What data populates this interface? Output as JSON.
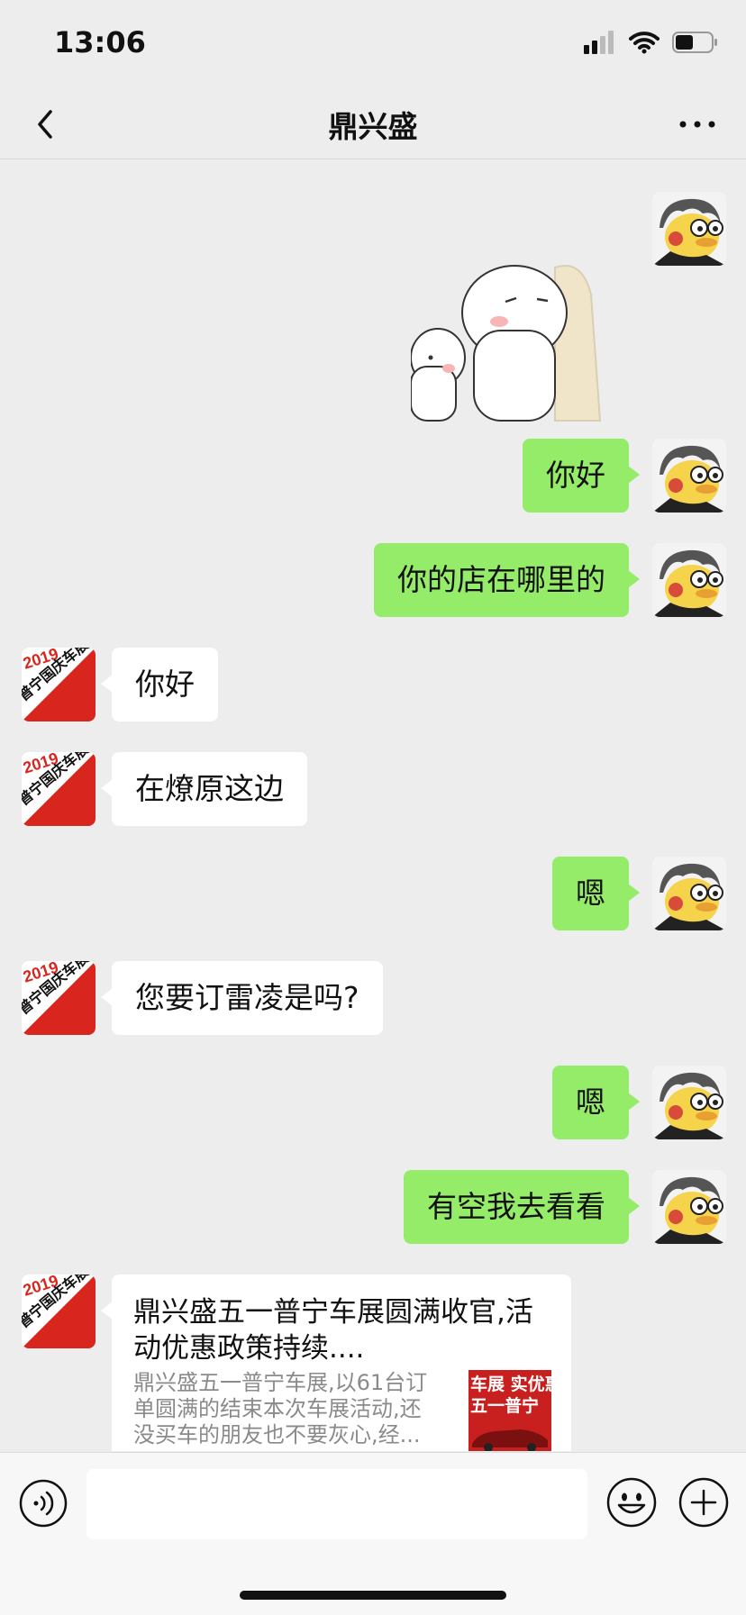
{
  "status_bar": {
    "time": "13:06",
    "battery_level": 0.5
  },
  "nav": {
    "title": "鼎兴盛"
  },
  "messages": [
    {
      "from": "me",
      "type": "sticker"
    },
    {
      "from": "me",
      "text": "你好"
    },
    {
      "from": "me",
      "text": "你的店在哪里的"
    },
    {
      "from": "shop",
      "text": "你好"
    },
    {
      "from": "shop",
      "text": "在燎原这边"
    },
    {
      "from": "me",
      "text": "嗯"
    },
    {
      "from": "shop",
      "text": "您要订雷凌是吗?"
    },
    {
      "from": "me",
      "text": "嗯"
    },
    {
      "from": "me",
      "text": "有空我去看看"
    },
    {
      "from": "shop",
      "type": "link",
      "title": "鼎兴盛五一普宁车展圆满收官,活动优惠政策持续....",
      "description": "鼎兴盛五一普宁车展,以61台订单圆满的结束本次车展活动,还没买车的朋友也不要灰心,经...",
      "thumbnail_text": [
        "车展 实优惠",
        "五一普宁"
      ]
    }
  ],
  "shop_avatar": {
    "year": "2019",
    "text": "普宁国庆车展"
  },
  "input": {
    "placeholder": ""
  },
  "colors": {
    "bubble_me": "#95ec69",
    "bubble_shop": "#ffffff",
    "background": "#ededed",
    "shop_avatar_red": "#d8261f"
  },
  "icons": {
    "back": "chevron-left-icon",
    "more": "more-dots-icon",
    "voice": "voice-icon",
    "emoji": "emoji-icon",
    "plus": "plus-icon"
  }
}
